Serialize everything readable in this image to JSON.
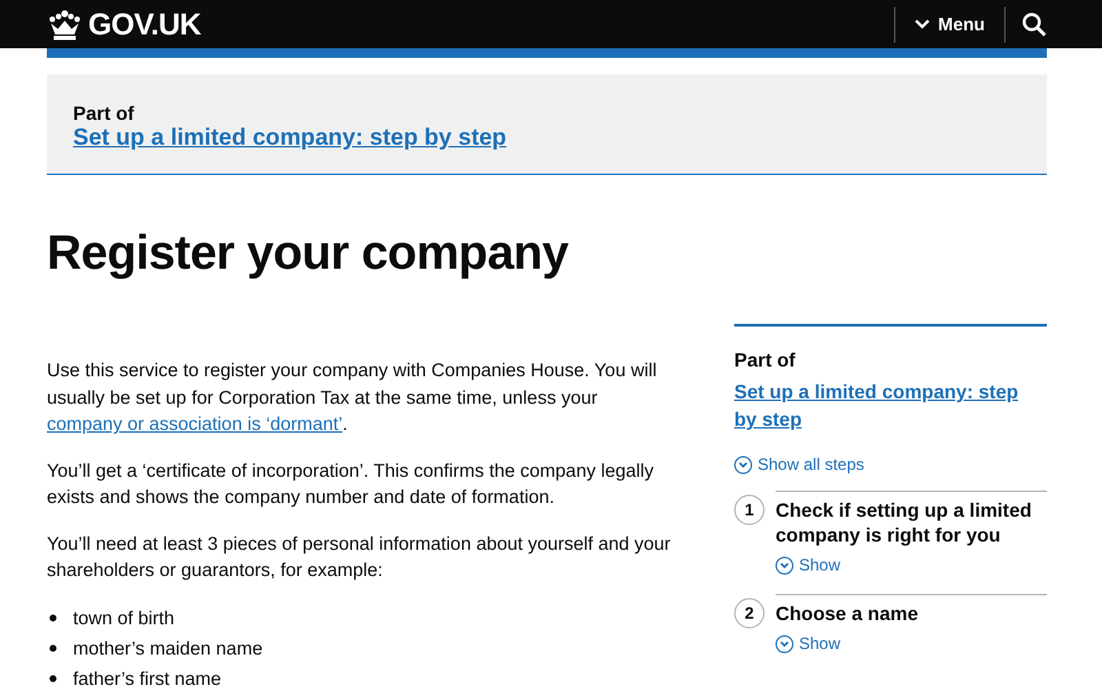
{
  "header": {
    "logo": "GOV.UK",
    "menu": "Menu"
  },
  "part_of": {
    "label": "Part of",
    "link": "Set up a limited company: step by step"
  },
  "title": "Register your company",
  "body": {
    "paragraphs": [
      {
        "text": "Use this service to register your company with Companies House. You will usually be set up for Corporation Tax at the same time, unless your",
        "link": "company or association is ‘dormant’",
        "after": "."
      },
      {
        "text": "You’ll get a ‘certificate of incorporation’. This confirms the company legally exists and shows the company number and date of formation."
      },
      {
        "text": "You’ll need at least 3 pieces of personal information about yourself and your shareholders or guarantors, for example:"
      }
    ],
    "list": [
      "town of birth",
      "mother’s maiden name",
      "father’s first name"
    ]
  },
  "sidebar": {
    "label": "Part of",
    "link": "Set up a limited company: step by step",
    "show_all": "Show all steps",
    "steps": [
      {
        "number": "1",
        "title": "Check if setting up a limited company is right for you",
        "toggle": "Show"
      },
      {
        "number": "2",
        "title": "Choose a name",
        "toggle": "Show"
      }
    ]
  }
}
